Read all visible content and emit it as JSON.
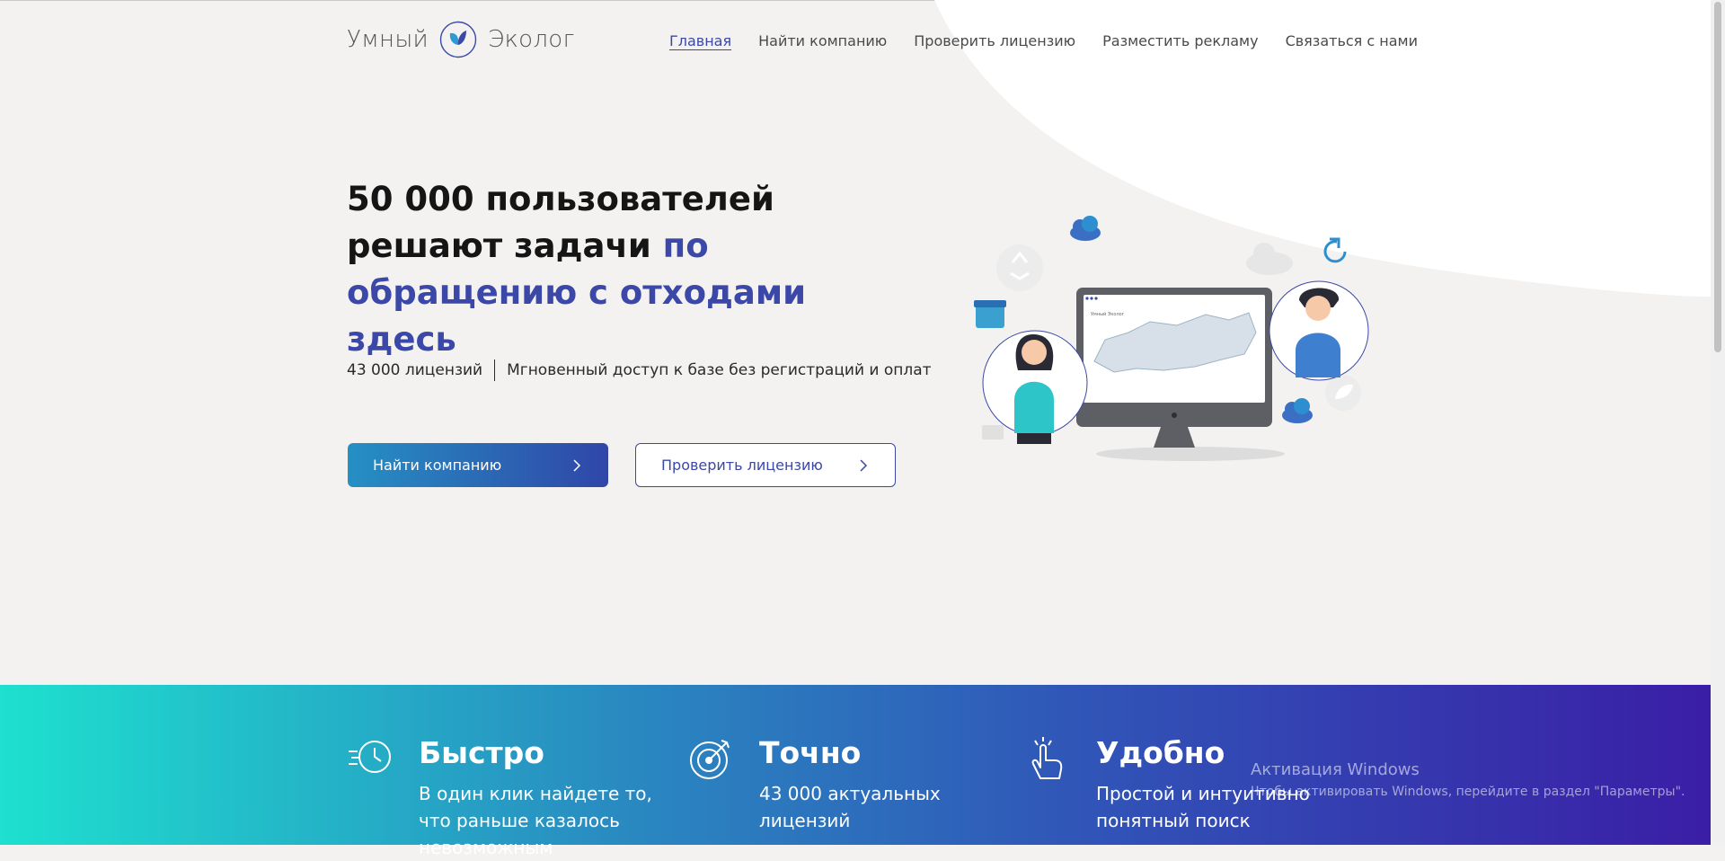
{
  "brand": {
    "word1": "Умный",
    "word2": "Эколог"
  },
  "nav": [
    {
      "label": "Главная",
      "active": true
    },
    {
      "label": "Найти компанию"
    },
    {
      "label": "Проверить лицензию"
    },
    {
      "label": "Разместить рекламу"
    },
    {
      "label": "Связаться с нами"
    }
  ],
  "hero": {
    "title_part1": "50 000 пользователей решают задачи",
    "title_highlight": "по обращению с отходами здесь",
    "stat_licenses": "43 000 лицензий",
    "stat_access": "Мгновенный доступ к базе без регистраций и оплат",
    "btn_find": "Найти компанию",
    "btn_check": "Проверить лицензию"
  },
  "illustration": {
    "screen_logo": "Умный Эколог"
  },
  "features": [
    {
      "icon": "clock-fast-icon",
      "title": "Быстро",
      "text": "В один клик найдете то, что раньше казалось невозможным"
    },
    {
      "icon": "target-icon",
      "title": "Точно",
      "text": "43 000 актуальных лицензий"
    },
    {
      "icon": "hand-click-icon",
      "title": "Удобно",
      "text": "Простой и интуитивно понятный поиск"
    }
  ],
  "watermark": {
    "line1": "Активация Windows",
    "line2": "Чтобы активировать Windows, перейдите в раздел \"Параметры\"."
  },
  "colors": {
    "accent": "#3b48a8",
    "band_start": "#1ee0cf",
    "band_end": "#3a1ea6",
    "page_bg": "#f3f2f1"
  }
}
